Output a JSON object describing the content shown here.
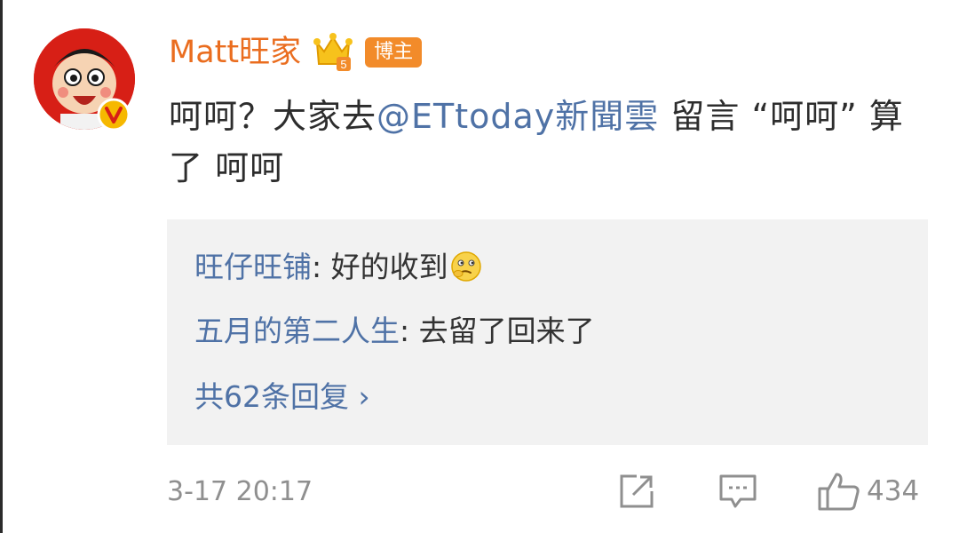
{
  "post": {
    "author": "Matt旺家",
    "badge": "博主",
    "text_before": "呵呵？大家去",
    "mention": "@ETtoday新聞雲",
    "text_after": " 留言 “呵呵” 算了 呵呵"
  },
  "replies": [
    {
      "user": "旺仔旺铺",
      "text": ": 好的收到",
      "emoji": "thinking-emoji"
    },
    {
      "user": "五月的第二人生",
      "text": ": 去留了回来了"
    }
  ],
  "more_replies": "共62条回复 ›",
  "footer": {
    "timestamp": "3-17 20:17",
    "like_count": "434"
  },
  "icons": {
    "verified": "verified-v-icon",
    "crown": "crown-level-icon",
    "share": "share-icon",
    "comment": "comment-icon",
    "like": "thumbs-up-icon"
  },
  "colors": {
    "username": "#ea6d1f",
    "link": "#4f72a6",
    "badge": "#f28b2a",
    "muted": "#8f8f8f"
  }
}
